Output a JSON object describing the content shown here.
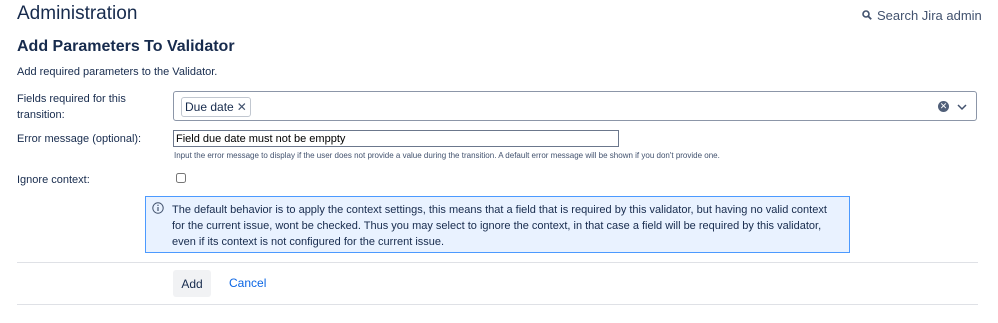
{
  "header": {
    "title": "Administration",
    "search_label": "Search Jira admin"
  },
  "form": {
    "title": "Add Parameters To Validator",
    "intro": "Add required parameters to the Validator.",
    "fields_label": "Fields required for this transition:",
    "selected_fields": [
      {
        "label": "Due date"
      }
    ],
    "error_label": "Error message (optional):",
    "error_value": "Field due date must not be emppty",
    "error_help": "Input the error message to display if the user does not provide a value during the transition. A default error message will be shown if you don't provide one.",
    "ignore_label": "Ignore context:",
    "ignore_checked": false,
    "info_text": "The default behavior is to apply the context settings, this means that a field that is required by this validator, but having no valid context for the current issue, wont be checked. Thus you may select to ignore the context, in that case a field will be required by this validator, even if its context is not configured for the current issue.",
    "add_label": "Add",
    "cancel_label": "Cancel"
  },
  "colors": {
    "link": "#0c66e4",
    "info_border": "#4c9aff",
    "info_background": "#e9f2ff",
    "text": "#172b4d"
  },
  "icons": [
    "search-icon",
    "remove-icon",
    "clear-icon",
    "chevron-down-icon",
    "info-icon"
  ]
}
